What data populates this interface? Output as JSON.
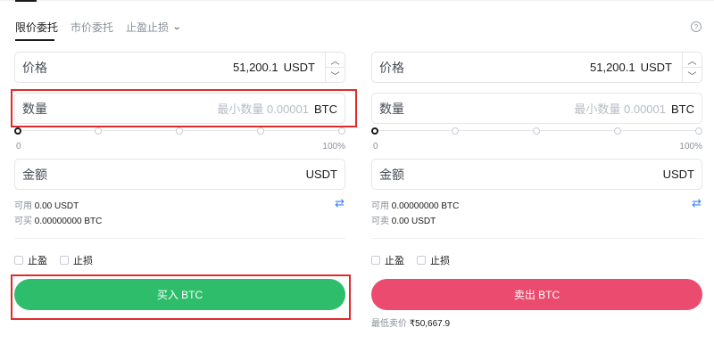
{
  "tabs": [
    {
      "label": "限价委托",
      "active": true
    },
    {
      "label": "市价委托",
      "active": false
    },
    {
      "label": "止盈止损",
      "active": false
    }
  ],
  "buy": {
    "price_label": "价格",
    "price_value": "51,200.1",
    "price_unit": "USDT",
    "qty_label": "数量",
    "qty_placeholder": "最小数量 0.00001",
    "qty_unit": "BTC",
    "slider_min": "0",
    "slider_max": "100%",
    "slider_value_percent": 0,
    "amount_label": "金额",
    "amount_unit": "USDT",
    "avail_key": "可用",
    "avail_value": "0.00 USDT",
    "can_key": "可买",
    "can_value": "0.00000000 BTC",
    "tp_label": "止盈",
    "sl_label": "止损",
    "button_label": "买入 BTC"
  },
  "sell": {
    "price_label": "价格",
    "price_value": "51,200.1",
    "price_unit": "USDT",
    "qty_label": "数量",
    "qty_placeholder": "最小数量 0.00001",
    "qty_unit": "BTC",
    "slider_min": "0",
    "slider_max": "100%",
    "slider_value_percent": 0,
    "amount_label": "金额",
    "amount_unit": "USDT",
    "avail_key": "可用",
    "avail_value": "0.00000000 BTC",
    "can_key": "可卖",
    "can_value": "0.00 USDT",
    "tp_label": "止盈",
    "sl_label": "止损",
    "button_label": "卖出 BTC",
    "min_price_key": "最低卖价",
    "min_price_value": "₹50,667.9"
  },
  "colors": {
    "buy": "#2ebd6b",
    "sell": "#eb4b6e",
    "highlight": "#e02b2b",
    "accent": "#3b82f6"
  },
  "icons": {
    "help": "question-circle-icon",
    "swap": "swap-arrows-icon",
    "chevron": "chevron-down-icon"
  }
}
